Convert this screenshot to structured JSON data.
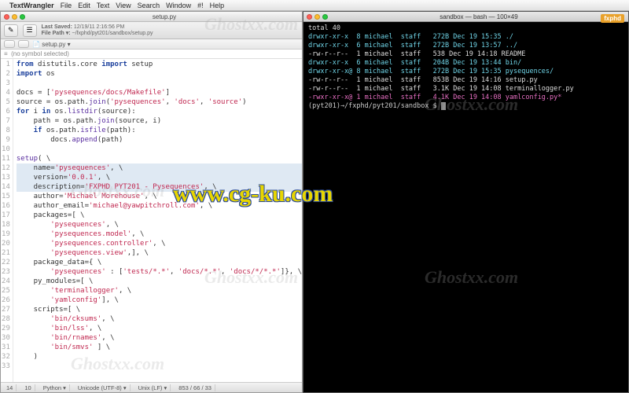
{
  "menubar": {
    "apple": "",
    "appname": "TextWrangler",
    "items": [
      "File",
      "Edit",
      "Text",
      "View",
      "Search",
      "Window",
      "#!",
      "Help"
    ]
  },
  "editor": {
    "title": "setup.py",
    "toolbar": {
      "new_icon": "✎",
      "list_icon": "☰",
      "last_saved_label": "Last Saved:",
      "last_saved_value": "12/19/11 2:16:56 PM",
      "file_path_label": "File Path ▾:",
      "file_path_value": "~/fxphd/pyt201/sandbox/setup.py"
    },
    "pathbar": {
      "doc": "setup.py"
    },
    "symbolbar": {
      "text": "(no symbol selected)"
    },
    "code_lines": [
      {
        "n": 1,
        "html": "<span class='kw'>from</span> distutils.core <span class='kw'>import</span> setup"
      },
      {
        "n": 2,
        "html": "<span class='kw'>import</span> os"
      },
      {
        "n": 3,
        "html": ""
      },
      {
        "n": 4,
        "html": "docs = [<span class='str'>'pysequences/docs/Makefile'</span>]"
      },
      {
        "n": 5,
        "html": "source = os.path.<span class='fn'>join</span>(<span class='str'>'pysequences'</span>, <span class='str'>'docs'</span>, <span class='str'>'source'</span>)"
      },
      {
        "n": 6,
        "html": "<span class='kw'>for</span> i <span class='kw'>in</span> os.<span class='fn'>listdir</span>(source):"
      },
      {
        "n": 7,
        "html": "    path = os.path.<span class='fn'>join</span>(source, i)"
      },
      {
        "n": 8,
        "html": "    <span class='kw'>if</span> os.path.<span class='fn'>isfile</span>(path):"
      },
      {
        "n": 9,
        "html": "        docs.<span class='fn'>append</span>(path)"
      },
      {
        "n": 10,
        "html": ""
      },
      {
        "n": 11,
        "html": "<span class='fn'>setup</span>( \\"
      },
      {
        "n": 12,
        "html": "    name=<span class='str'>'pysequences'</span>, \\",
        "hl": true
      },
      {
        "n": 13,
        "html": "    version=<span class='str'>'0.0.1'</span>, \\",
        "hl": true
      },
      {
        "n": 14,
        "html": "    description=<span class='str'>'FXPHD PYT201 - Pysequences'</span>, \\",
        "hl": true
      },
      {
        "n": 15,
        "html": "    author=<span class='str'>'Michael Morehouse'</span>, \\"
      },
      {
        "n": 16,
        "html": "    author_email=<span class='str'>'michael@yawpitchroll.com'</span>, \\"
      },
      {
        "n": 17,
        "html": "    packages=[ \\"
      },
      {
        "n": 18,
        "html": "        <span class='str'>'pysequences'</span>, \\"
      },
      {
        "n": 19,
        "html": "        <span class='str'>'pysequences.model'</span>, \\"
      },
      {
        "n": 20,
        "html": "        <span class='str'>'pysequences.controller'</span>, \\"
      },
      {
        "n": 21,
        "html": "        <span class='str'>'pysequences.view'</span>,], \\"
      },
      {
        "n": 22,
        "html": "    package_data={ \\"
      },
      {
        "n": 23,
        "html": "        <span class='str'>'pysequences'</span> : [<span class='str'>'tests/*.*'</span>, <span class='str'>'docs/*.*'</span>, <span class='str'>'docs/*/*.*'</span>]}, \\"
      },
      {
        "n": 24,
        "html": "    py_modules=[ \\"
      },
      {
        "n": 25,
        "html": "        <span class='str'>'terminallogger'</span>, \\"
      },
      {
        "n": 26,
        "html": "        <span class='str'>'yamlconfig'</span>], \\"
      },
      {
        "n": 27,
        "html": "    scripts=[ \\"
      },
      {
        "n": 28,
        "html": "        <span class='str'>'bin/cksums'</span>, \\"
      },
      {
        "n": 29,
        "html": "        <span class='str'>'bin/lss'</span>, \\"
      },
      {
        "n": 30,
        "html": "        <span class='str'>'bin/rnames'</span>, \\"
      },
      {
        "n": 31,
        "html": "        <span class='str'>'bin/smvs'</span> ] \\"
      },
      {
        "n": 32,
        "html": "    )"
      },
      {
        "n": 33,
        "html": ""
      }
    ],
    "status": {
      "line": "14",
      "col": "10",
      "lang": "Python ▾",
      "enc": "Unicode (UTF-8) ▾",
      "le": "Unix (LF) ▾",
      "sel": "853 / 66 / 33"
    }
  },
  "terminal": {
    "title": "sandbox — bash — 100×49",
    "lines": [
      {
        "text": "total 40",
        "cls": ""
      },
      {
        "text": "drwxr-xr-x  8 michael  staff   272B Dec 19 15:35 ./",
        "cls": "cyan"
      },
      {
        "text": "drwxr-xr-x  6 michael  staff   272B Dec 19 13:57 ../",
        "cls": "cyan"
      },
      {
        "text": "-rw-r--r--  1 michael  staff   538 Dec 19 14:18 README",
        "cls": ""
      },
      {
        "text": "drwxr-xr-x  6 michael  staff   204B Dec 19 13:44 bin/",
        "cls": "cyan"
      },
      {
        "text": "drwxr-xr-x@ 8 michael  staff   272B Dec 19 15:35 pysequences/",
        "cls": "cyan"
      },
      {
        "text": "-rw-r--r--  1 michael  staff   853B Dec 19 14:16 setup.py",
        "cls": ""
      },
      {
        "text": "-rw-r--r--  1 michael  staff   3.1K Dec 19 14:08 terminallogger.py",
        "cls": ""
      },
      {
        "text": "-rwxr-xr-x@ 1 michael  staff   4.1K Dec 19 14:08 yamlconfig.py*",
        "cls": "mag"
      }
    ],
    "prompt": "(pyt201)→/fxphd/pyt201/sandbox $"
  },
  "watermarks": {
    "ghost": "Ghostxx.com",
    "cgku": "www.cg-ku.com",
    "logo": "fxphd"
  }
}
